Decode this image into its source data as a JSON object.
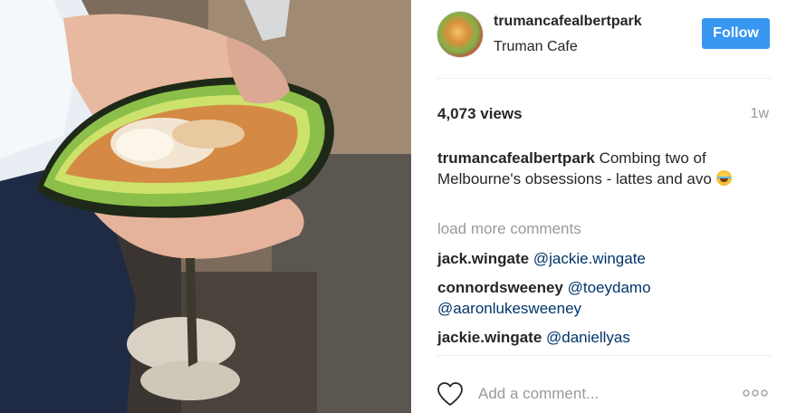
{
  "post": {
    "photo_icon": "avocado-latte-photo"
  },
  "header": {
    "username": "trumancafealbertpark",
    "location": "Truman Cafe",
    "follow_label": "Follow",
    "follow_color": "#3897f0"
  },
  "stats": {
    "views": "4,073 views",
    "time": "1w"
  },
  "caption": {
    "username": "trumancafealbertpark",
    "text": "Combing two of Melbourne's obsessions - lattes and avo",
    "emoji_icon": "tears-of-joy-emoji"
  },
  "comments": {
    "load_more": "load more comments",
    "items": [
      {
        "username": "jack.wingate",
        "mentions": [
          "@jackie.wingate"
        ]
      },
      {
        "username": "connordsweeney",
        "mentions": [
          "@toeydamo",
          "@aaronlukesweeney"
        ]
      },
      {
        "username": "jackie.wingate",
        "mentions": [
          "@daniellyas"
        ]
      }
    ]
  },
  "footer": {
    "add_comment_placeholder": "Add a comment...",
    "like_icon": "heart-icon",
    "more_icon": "more-options-icon"
  },
  "colors": {
    "link": "#003569",
    "muted": "#999999",
    "text": "#262626"
  }
}
